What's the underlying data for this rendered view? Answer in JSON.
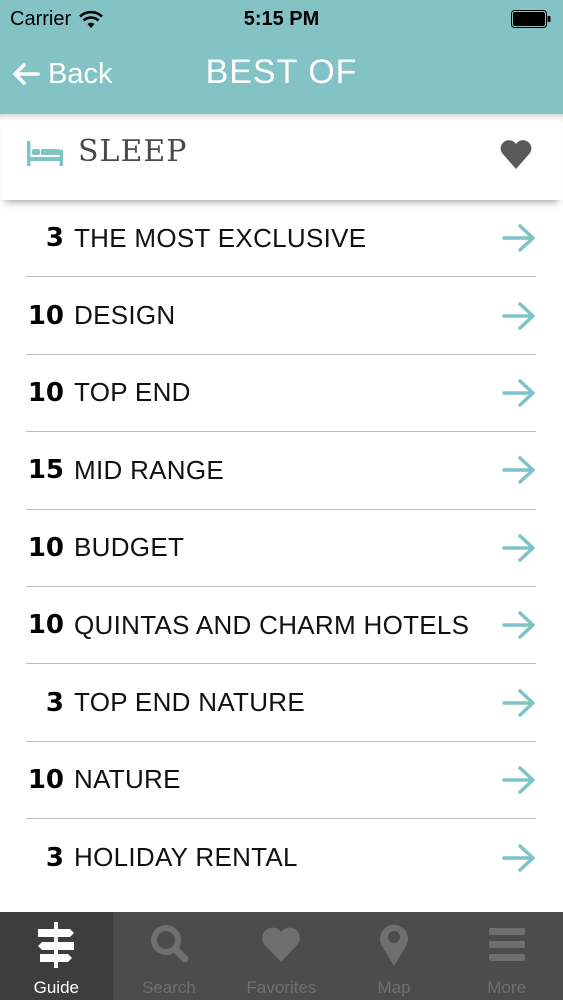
{
  "status_bar": {
    "carrier": "Carrier",
    "time": "5:15 PM"
  },
  "nav": {
    "back_label": "Back",
    "title": "BEST OF"
  },
  "section": {
    "title": "SLEEP",
    "icon": "bed-icon"
  },
  "list": [
    {
      "count": "3",
      "label": "THE MOST EXCLUSIVE"
    },
    {
      "count": "10",
      "label": "DESIGN"
    },
    {
      "count": "10",
      "label": "TOP END"
    },
    {
      "count": "15",
      "label": "MID RANGE"
    },
    {
      "count": "10",
      "label": "BUDGET"
    },
    {
      "count": "10",
      "label": "QUINTAS AND CHARM HOTELS"
    },
    {
      "count": "3",
      "label": "TOP END NATURE"
    },
    {
      "count": "10",
      "label": "NATURE"
    },
    {
      "count": "3",
      "label": "HOLIDAY RENTAL"
    }
  ],
  "tabs": [
    {
      "label": "Guide",
      "icon": "signpost-icon",
      "active": true
    },
    {
      "label": "Search",
      "icon": "search-icon",
      "active": false
    },
    {
      "label": "Favorites",
      "icon": "heart-icon",
      "active": false
    },
    {
      "label": "Map",
      "icon": "map-pin-icon",
      "active": false
    },
    {
      "label": "More",
      "icon": "menu-icon",
      "active": false
    }
  ],
  "colors": {
    "header_bg": "#83c2c5",
    "accent": "#7ec3c6",
    "tab_bar_bg": "#4c4c4c",
    "tab_inactive": "#6f6f6f",
    "section_text": "#4a4a4a"
  }
}
